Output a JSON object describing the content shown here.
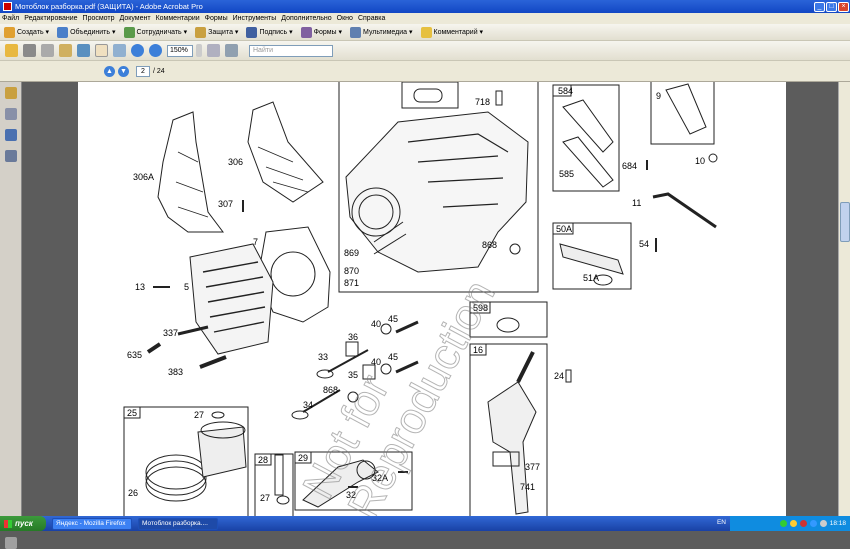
{
  "window": {
    "title": "Мотоблок разборка.pdf (ЗАЩИТА) - Adobe Acrobat Pro",
    "minimize": "_",
    "maximize": "□",
    "close": "×"
  },
  "menu": [
    "Файл",
    "Редактирование",
    "Просмотр",
    "Документ",
    "Комментарии",
    "Формы",
    "Инструменты",
    "Дополнительно",
    "Окно",
    "Справка"
  ],
  "toolbar": {
    "create": "Создать",
    "combine": "Объединить",
    "collaborate": "Сотрудничать",
    "protect": "Защита",
    "sign": "Подпись",
    "forms": "Формы",
    "multimedia": "Мультимедиа",
    "comment": "Комментарий"
  },
  "viewbar": {
    "zoom": "150%",
    "find_placeholder": "Найти"
  },
  "navigation": {
    "current_page": "2",
    "total_pages": "/ 24"
  },
  "watermark": {
    "line1": "Not for",
    "line2": "Reproduction"
  },
  "diagram": {
    "boxes": [
      "584",
      "50A",
      "598",
      "16",
      "25",
      "28",
      "29"
    ],
    "labels": {
      "l306A": "306A",
      "l306": "306",
      "l307": "307",
      "l7": "7",
      "l13": "13",
      "l5": "5",
      "l337": "337",
      "l635": "635",
      "l383": "383",
      "l718": "718",
      "l869": "869",
      "l870": "870",
      "l871": "871",
      "l868a": "868",
      "l868b": "868",
      "l585": "585",
      "l684": "684",
      "l9": "9",
      "l10": "10",
      "l11": "11",
      "l54": "54",
      "l51A": "51A",
      "l36": "36",
      "l40a": "40",
      "l45a": "45",
      "l33": "33",
      "l40b": "40",
      "l45b": "45",
      "l35": "35",
      "l34": "34",
      "l24": "24",
      "l27a": "27",
      "l26": "26",
      "l27b": "27",
      "l32": "32",
      "l32A": "32A",
      "l377": "377",
      "l741": "741"
    }
  },
  "taskbar": {
    "start": "пуск",
    "tasks": [
      "Яндекс - Mozilla Firefox",
      "Мотоблок разборка...."
    ],
    "lang": "EN",
    "clock": "18:18"
  }
}
